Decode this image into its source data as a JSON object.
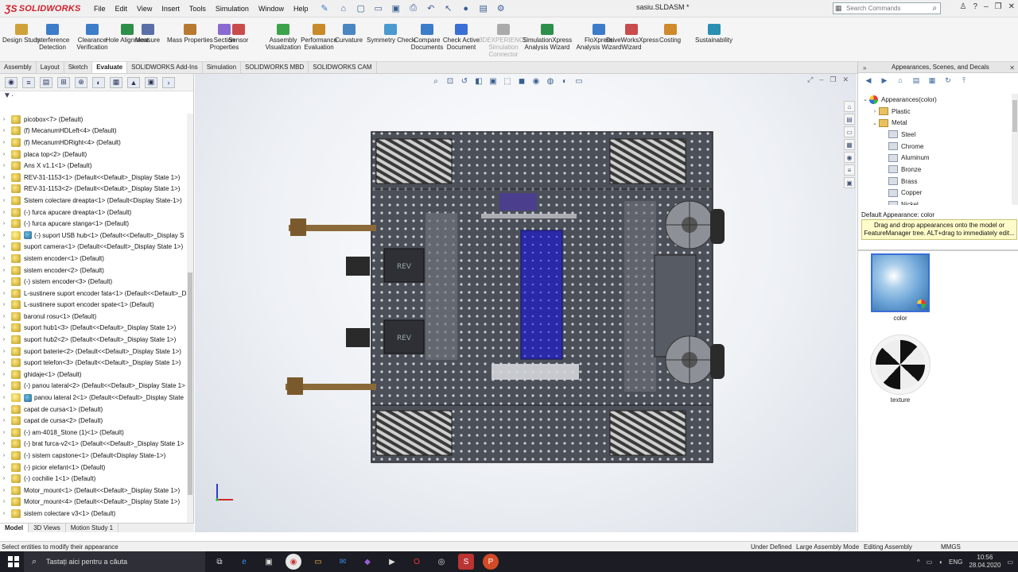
{
  "app": {
    "name": "SOLIDWORKS",
    "doc_title": "sasiu.SLDASM *"
  },
  "menu": [
    "File",
    "Edit",
    "View",
    "Insert",
    "Tools",
    "Simulation",
    "Window",
    "Help"
  ],
  "search": {
    "placeholder": "Search Commands"
  },
  "ribbon": [
    {
      "label": "Design Study"
    },
    {
      "label": "Interference Detection"
    },
    {
      "label": "Clearance Verification"
    },
    {
      "label": "Hole Alignment"
    },
    {
      "label": "Measure"
    },
    {
      "label": "Mass Properties"
    },
    {
      "label": "Section Properties"
    },
    {
      "label": "Sensor"
    },
    {
      "label": "Assembly Visualization"
    },
    {
      "label": "Performance Evaluation"
    },
    {
      "label": "Curvature"
    },
    {
      "label": "Symmetry Check"
    },
    {
      "label": "Compare Documents"
    },
    {
      "label": "Check Active Document"
    },
    {
      "label": "3DEXPERIENCE Simulation Connector"
    },
    {
      "label": "SimulationXpress Analysis Wizard"
    },
    {
      "label": "FloXpress Analysis Wizard"
    },
    {
      "label": "DriveWorksXpress Wizard"
    },
    {
      "label": "Costing"
    },
    {
      "label": "Sustainability"
    }
  ],
  "tabs": [
    "Assembly",
    "Layout",
    "Sketch",
    "Evaluate",
    "SOLIDWORKS Add-Ins",
    "Simulation",
    "SOLIDWORKS MBD",
    "SOLIDWORKS CAM"
  ],
  "active_tab": "Evaluate",
  "tree_items": [
    "picobox<7> (Default)",
    "(f) MecanumHDLeft<4> (Default)",
    "(f) MecanumHDRight<4> (Default)",
    "placa top<2> (Default)",
    "Ans X v1.1<1> (Default)",
    "REV-31-1153<1> (Default<<Default>_Display State 1>)",
    "REV-31-1153<2> (Default<<Default>_Display State 1>)",
    "Sistem colectare dreapta<1> (Default<Display State-1>)",
    "(-) furca apucare dreapta<1> (Default)",
    "(-) furca apucare stanga<1> (Default)",
    "(-) suport USB hub<1> (Default<<Default>_Display S",
    "suport camera<1> (Default<<Default>_Display State 1>)",
    "sistem encoder<1> (Default)",
    "sistem encoder<2> (Default)",
    "(-) sistem encoder<3> (Default)",
    "L-sustinere suport encoder fata<1> (Default<<Default>_D",
    "L-sustinere suport encoder spate<1> (Default)",
    "baronul rosu<1> (Default)",
    "suport hub1<3> (Default<<Default>_Display State 1>)",
    "suport hub2<2> (Default<<Default>_Display State 1>)",
    "suport baterie<2> (Default<<Default>_Display State 1>)",
    "suport telefon<3> (Default<<Default>_Display State 1>)",
    "ghidaje<1> (Default)",
    "(-) panou lateral<2> (Default<<Default>_Display State 1>",
    "panou lateral 2<1> (Default<<Default>_Display State",
    "capat de cursa<1> (Default)",
    "capat de cursa<2> (Default)",
    "(-) am-4018_Stone (1)<1> (Default)",
    "(-) brat furca-v2<1> (Default<<Default>_Display State 1>",
    "(-) sistem capstone<1> (Default<Display State-1>)",
    "(-) picior elefant<1> (Default)",
    "(-) cochilie 1<1> (Default)",
    "Motor_mount<1> (Default<<Default>_Display State 1>)",
    "Motor_mount<4> (Default<<Default>_Display State 1>)",
    "sistem colectare v3<1> (Default)"
  ],
  "bottom_tabs": [
    "Model",
    "3D Views",
    "Motion Study 1"
  ],
  "task_pane": {
    "title": "Appearances, Scenes, and Decals",
    "tree": [
      {
        "label": "Appearances(color)",
        "level": 0,
        "kind": "root"
      },
      {
        "label": "Plastic",
        "level": 1,
        "kind": "folder"
      },
      {
        "label": "Metal",
        "level": 1,
        "kind": "folder"
      },
      {
        "label": "Steel",
        "level": 2,
        "kind": "item"
      },
      {
        "label": "Chrome",
        "level": 2,
        "kind": "item"
      },
      {
        "label": "Aluminum",
        "level": 2,
        "kind": "item"
      },
      {
        "label": "Bronze",
        "level": 2,
        "kind": "item"
      },
      {
        "label": "Brass",
        "level": 2,
        "kind": "item"
      },
      {
        "label": "Copper",
        "level": 2,
        "kind": "item"
      },
      {
        "label": "Nickel",
        "level": 2,
        "kind": "item"
      }
    ],
    "default_label": "Default Appearance: color",
    "tooltip": "Drag and drop appearances onto the model or FeatureManager tree.  ALT+drag to immediately edit...",
    "swatch1_label": "color",
    "swatch2_label": "texture"
  },
  "status": {
    "left": "Select entities to modify their appearance",
    "under_defined": "Under Defined",
    "large_mode": "Large Assembly Mode",
    "editing": "Editing Assembly",
    "units": "MMGS"
  },
  "taskbar": {
    "search_placeholder": "Tastați aici pentru a căuta",
    "lang": "ENG",
    "time": "10:56",
    "date": "28.04.2020"
  },
  "colors": {
    "brand_red": "#d11f2a",
    "chassis": "#4b4f58",
    "blue_plate": "#2a2aa8",
    "tooltip_bg": "#fefcc8"
  }
}
